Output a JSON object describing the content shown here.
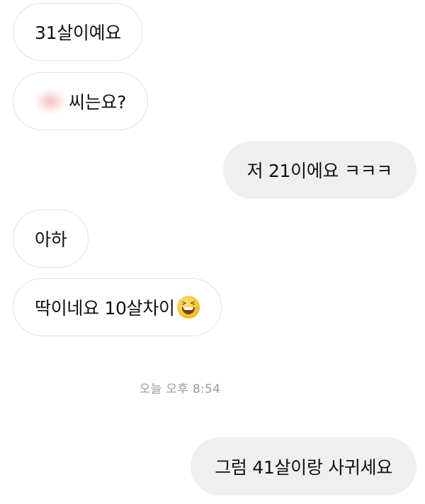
{
  "messages": [
    {
      "side": "incoming",
      "text": "31살이예요"
    },
    {
      "side": "incoming",
      "text": "씨는요?"
    },
    {
      "side": "outgoing",
      "text": "저 21이에요 ㅋㅋㅋ"
    },
    {
      "side": "incoming",
      "text": "아하"
    },
    {
      "side": "incoming",
      "text": "딱이네요 10살차이"
    },
    {
      "side": "outgoing",
      "text": "그럼 41살이랑 사귀세요"
    }
  ],
  "timestamp": "오늘 오후 8:54",
  "icons": {
    "redacted_name": "blurred-name",
    "emoji": "grinning-squinting-face"
  },
  "colors": {
    "background": "#ffffff",
    "incoming_border": "#e3e3e3",
    "outgoing_bg": "#efefef",
    "timestamp_text": "#9a9a9a"
  }
}
